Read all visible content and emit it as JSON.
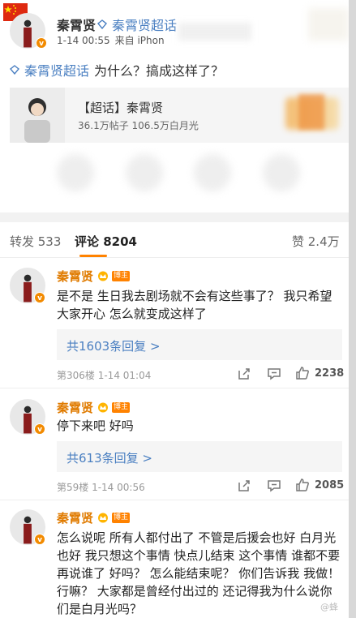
{
  "post": {
    "author": "秦霄贤",
    "chaohua_label": "秦霄贤超话",
    "time": "1-14 00:55",
    "source": "来自 iPhon",
    "tag": "秦霄贤超话",
    "text": "为什么？搞成这样了？",
    "card": {
      "title": "【超话】秦霄贤",
      "stats": "36.1万帖子 106.5万白月光"
    }
  },
  "tabs": {
    "repost": "转发 533",
    "comment": "评论 8204",
    "like": "赞 2.4万"
  },
  "comments": [
    {
      "name": "秦霄贤",
      "badge": "博主",
      "text": "是不是 生日我去剧场就不会有这些事了？ 我只希望大家开心 怎么就变成这样了",
      "reply": "共1603条回复 >",
      "meta": "第306楼 1-14 01:04",
      "likes": "2238"
    },
    {
      "name": "秦霄贤",
      "badge": "博主",
      "text": "停下来吧 好吗",
      "reply": "共613条回复 >",
      "meta": "第59楼 1-14 00:56",
      "likes": "2085"
    },
    {
      "name": "秦霄贤",
      "badge": "博主",
      "text": "怎么说呢 所有人都付出了 不管是后援会也好 白月光也好 我只想这个事情 快点儿结束 这个事情 谁都不要再说谁了 好吗？ 怎么能结束呢？ 你们告诉我 我做！ 行嘛？ 大家都是曾经付出过的 还记得我为什么说你们是白月光吗？"
    }
  ],
  "watermark": "@蜂",
  "colors": {
    "accent": "#ff8200",
    "link": "#4a7fc1",
    "name": "#e07b00"
  },
  "icons": [
    "china-flag-icon",
    "chaohua-diamond-icon",
    "crown-icon",
    "share-icon",
    "comment-icon",
    "like-icon",
    "verified-v-icon"
  ]
}
